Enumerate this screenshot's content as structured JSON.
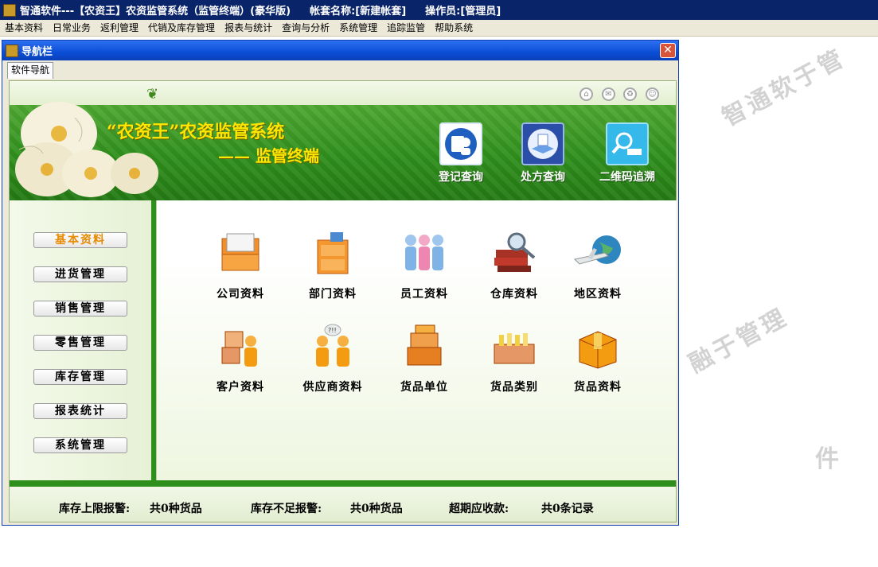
{
  "titlebar": {
    "app": "智通软件---【农资王】农资监管系统（监管终端）(豪华版)",
    "account": "帐套名称:[新建帐套]",
    "operator": "操作员:[管理员]"
  },
  "menu": [
    "基本资料",
    "日常业务",
    "返利管理",
    "代销及库存管理",
    "报表与统计",
    "查询与分析",
    "系统管理",
    "追踪监管",
    "帮助系统"
  ],
  "watermark": {
    "line1": "智通软于管",
    "line2": "融于管理",
    "line3": "件"
  },
  "window": {
    "title": "导航栏",
    "tab": "软件导航"
  },
  "banner": {
    "title1": "“农资王”农资监管系统",
    "title2": "—— 监管终端",
    "quick": [
      {
        "label": "登记查询",
        "icon": "registry-query-icon"
      },
      {
        "label": "处方查询",
        "icon": "prescription-query-icon"
      },
      {
        "label": "二维码追溯",
        "icon": "qrcode-trace-icon"
      }
    ]
  },
  "sidebar": {
    "items": [
      "基本资料",
      "进货管理",
      "销售管理",
      "零售管理",
      "库存管理",
      "报表统计",
      "系统管理"
    ],
    "active": 0
  },
  "modules": [
    {
      "label": "公司资料",
      "icon": "file-drawer-icon"
    },
    {
      "label": "部门资料",
      "icon": "file-cabinet-icon"
    },
    {
      "label": "员工资料",
      "icon": "staff-people-icon"
    },
    {
      "label": "仓库资料",
      "icon": "books-magnifier-icon"
    },
    {
      "label": "地区资料",
      "icon": "airplane-globe-icon"
    },
    {
      "label": "客户资料",
      "icon": "customer-boxes-icon"
    },
    {
      "label": "供应商资料",
      "icon": "supplier-people-icon"
    },
    {
      "label": "货品单位",
      "icon": "stacked-boxes-icon"
    },
    {
      "label": "货品类别",
      "icon": "bottle-crate-icon"
    },
    {
      "label": "货品资料",
      "icon": "package-icon"
    }
  ],
  "status": {
    "upper_label": "库存上限报警:",
    "upper_value": "共0种货品",
    "lower_label": "库存不足报警:",
    "lower_value": "共0种货品",
    "overdue_label": "超期应收款:",
    "overdue_value": "共0条记录"
  },
  "colors": {
    "titlebar": "#0a246a",
    "banner_green": "#2f8f1c",
    "title_yellow": "#ffe600",
    "active_menu": "#e88a00"
  }
}
